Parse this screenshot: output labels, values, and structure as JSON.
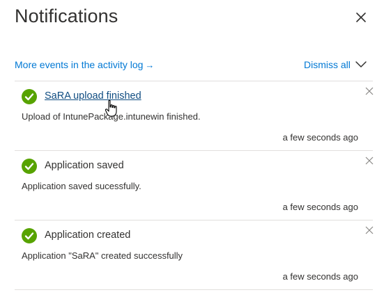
{
  "panel": {
    "title": "Notifications",
    "close_icon": "close-icon"
  },
  "toolbar": {
    "activity_link_label": "More events in the activity log",
    "activity_link_arrow": "→",
    "dismiss_all_label": "Dismiss all",
    "expand_icon": "chevron-down-icon"
  },
  "colors": {
    "link": "#0078d4",
    "success": "#57a300",
    "text": "#323130",
    "divider": "#e1dfdd"
  },
  "notifications": [
    {
      "status_icon": "success-check-icon",
      "title": "SaRA upload finished",
      "title_is_link": true,
      "body": "Upload of IntunePackage.intunewin finished.",
      "time": "a few seconds ago"
    },
    {
      "status_icon": "success-check-icon",
      "title": "Application saved",
      "title_is_link": false,
      "body": "Application saved sucessfully.",
      "time": "a few seconds ago"
    },
    {
      "status_icon": "success-check-icon",
      "title": "Application created",
      "title_is_link": false,
      "body": "Application \"SaRA\" created successfully",
      "time": "a few seconds ago"
    }
  ]
}
